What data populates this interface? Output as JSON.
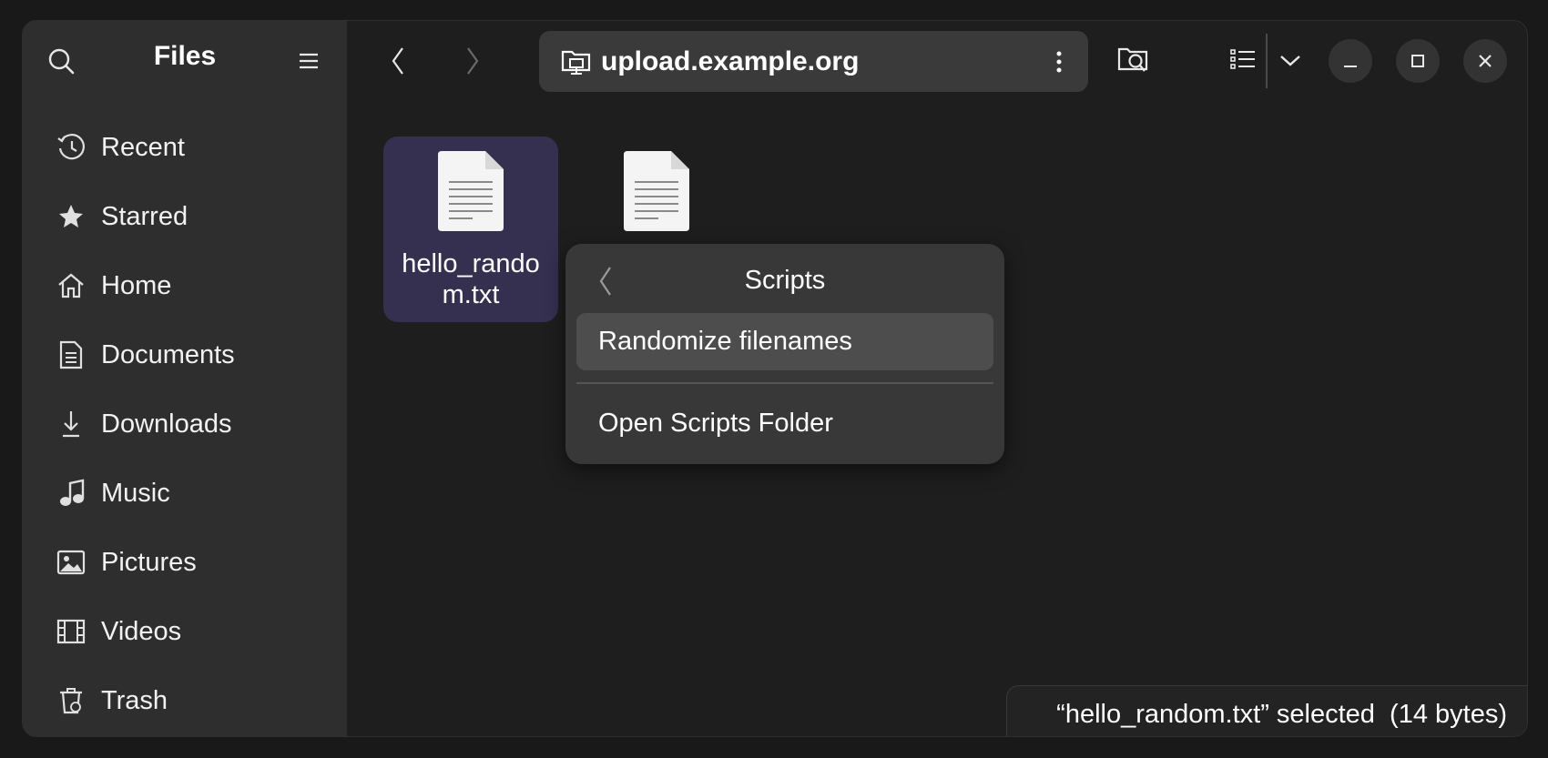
{
  "app": {
    "title": "Files"
  },
  "sidebar": {
    "items": [
      {
        "label": "Recent",
        "icon": "clock-icon"
      },
      {
        "label": "Starred",
        "icon": "star-icon"
      },
      {
        "label": "Home",
        "icon": "home-icon"
      },
      {
        "label": "Documents",
        "icon": "document-icon"
      },
      {
        "label": "Downloads",
        "icon": "download-icon"
      },
      {
        "label": "Music",
        "icon": "music-note-icon"
      },
      {
        "label": "Pictures",
        "icon": "image-icon"
      },
      {
        "label": "Videos",
        "icon": "film-icon"
      },
      {
        "label": "Trash",
        "icon": "trash-icon"
      }
    ]
  },
  "header": {
    "location": "upload.example.org",
    "location_icon": "remote-folder-icon"
  },
  "files": [
    {
      "name": "hello_random.txt",
      "display": "hello_rando m.txt",
      "selected": true,
      "icon": "text-file-icon"
    },
    {
      "name": "",
      "display": "",
      "selected": false,
      "icon": "text-file-icon"
    }
  ],
  "menu": {
    "title": "Scripts",
    "items": [
      {
        "label": "Randomize filenames",
        "hover": true
      },
      {
        "label": "Open Scripts Folder",
        "hover": false
      }
    ]
  },
  "status": {
    "text": "“hello_random.txt” selected  (14 bytes)"
  },
  "colors": {
    "accent_selection": "#353050",
    "sidebar_bg": "#2e2e2e",
    "content_bg": "#1e1e1e",
    "menu_bg": "#383838"
  }
}
